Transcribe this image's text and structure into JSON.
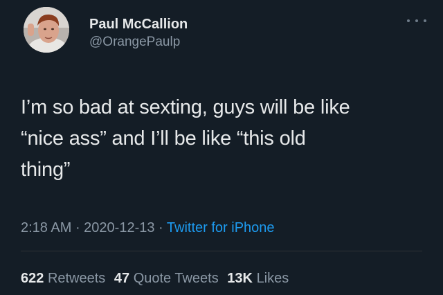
{
  "author": {
    "display_name": "Paul McCallion",
    "handle": "@OrangePaulp",
    "avatar_icon": "profile-photo"
  },
  "tweet": {
    "lines": [
      "I’m so bad at sexting, guys will be like",
      "“nice ass” and I’ll be like “this old",
      "thing”"
    ]
  },
  "meta": {
    "time": "2:18 AM",
    "sep1": " · ",
    "date": "2020-12-13",
    "sep2": " · ",
    "source": "Twitter for iPhone"
  },
  "stats": {
    "retweets_count": "622",
    "retweets_label": "Retweets",
    "quotes_count": "47",
    "quotes_label": "Quote Tweets",
    "likes_count": "13K",
    "likes_label": "Likes"
  },
  "colors": {
    "background": "#141d26",
    "text": "#e7e9ea",
    "secondary": "#8b98a5",
    "link": "#1d9bf0"
  },
  "icons": {
    "more": "more-horizontal-icon"
  }
}
